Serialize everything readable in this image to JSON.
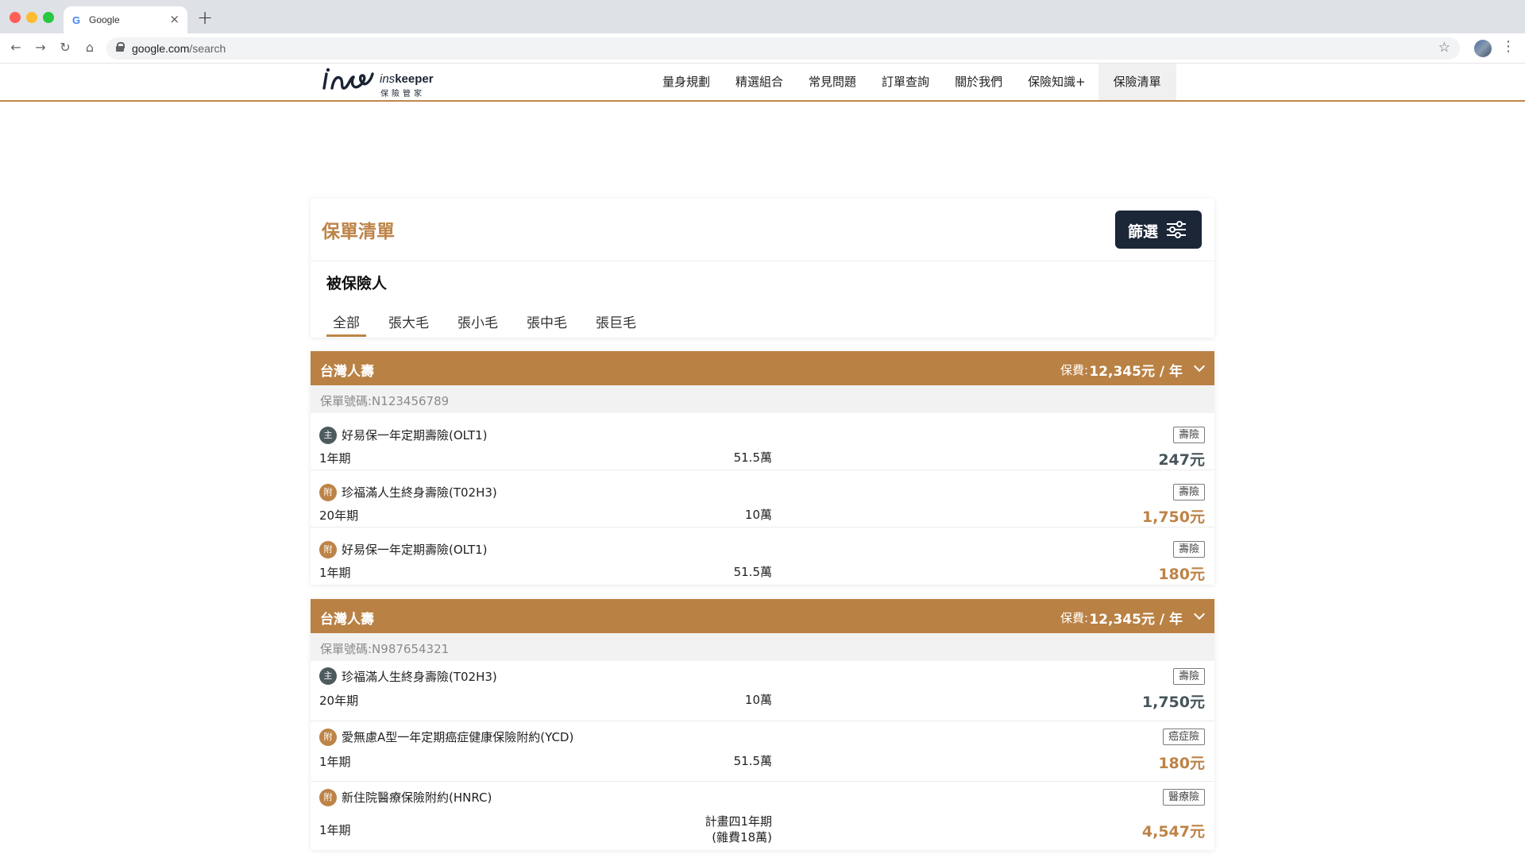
{
  "browser": {
    "tab_title": "Google",
    "tab_close": "×",
    "new_tab": "+",
    "url_host": "google.com",
    "url_path": "/search",
    "back": "←",
    "forward": "→",
    "reload": "↻",
    "home": "⌂",
    "star": "☆",
    "menu": "⋮"
  },
  "header": {
    "logo_en_prefix": "ins",
    "logo_en_suffix": "keeper",
    "logo_zh": "保險管家",
    "nav": [
      "量身規劃",
      "精選組合",
      "常見問題",
      "訂單查詢",
      "關於我們",
      "保險知識+",
      "保險清單"
    ],
    "active_nav": "保險清單"
  },
  "page": {
    "title": "保單清單",
    "filter_label": "篩選",
    "insured_label": "被保險人",
    "person_tabs": [
      "全部",
      "張大毛",
      "張小毛",
      "張中毛",
      "張巨毛"
    ],
    "active_person": "全部"
  },
  "policies": [
    {
      "company": "台灣人壽",
      "premium_label": "保費:",
      "premium_value": "12,345元 / 年",
      "number": "保單號碼:N123456789",
      "items": [
        {
          "role": "主",
          "name": "好易保一年定期壽險(OLT1)",
          "type": "壽險",
          "term": "1年期",
          "amount": "51.5萬",
          "price": "247元"
        },
        {
          "role": "附",
          "name": "珍福滿人生終身壽險(T02H3)",
          "type": "壽險",
          "term": "20年期",
          "amount": "10萬",
          "price": "1,750元"
        },
        {
          "role": "附",
          "name": "好易保一年定期壽險(OLT1)",
          "type": "壽險",
          "term": "1年期",
          "amount": "51.5萬",
          "price": "180元"
        }
      ]
    },
    {
      "company": "台灣人壽",
      "premium_label": "保費:",
      "premium_value": "12,345元 / 年",
      "number": "保單號碼:N987654321",
      "items": [
        {
          "role": "主",
          "name": "珍福滿人生終身壽險(T02H3)",
          "type": "壽險",
          "term": "20年期",
          "amount": "10萬",
          "price": "1,750元"
        },
        {
          "role": "附",
          "name": "愛無慮A型一年定期癌症健康保險附約(YCD)",
          "type": "癌症險",
          "term": "1年期",
          "amount": "51.5萬",
          "price": "180元"
        },
        {
          "role": "附",
          "name": "新住院醫療保險附約(HNRC)",
          "type": "醫療險",
          "term": "1年期",
          "amount_line1": "計畫四1年期",
          "amount_line2": "(雜費18萬)",
          "price": "4,547元"
        }
      ]
    }
  ],
  "colors": {
    "accent": "#bd8347",
    "header_bar": "#b98144",
    "dark_button": "#1b2637",
    "main_badge": "#4d5a5e"
  }
}
